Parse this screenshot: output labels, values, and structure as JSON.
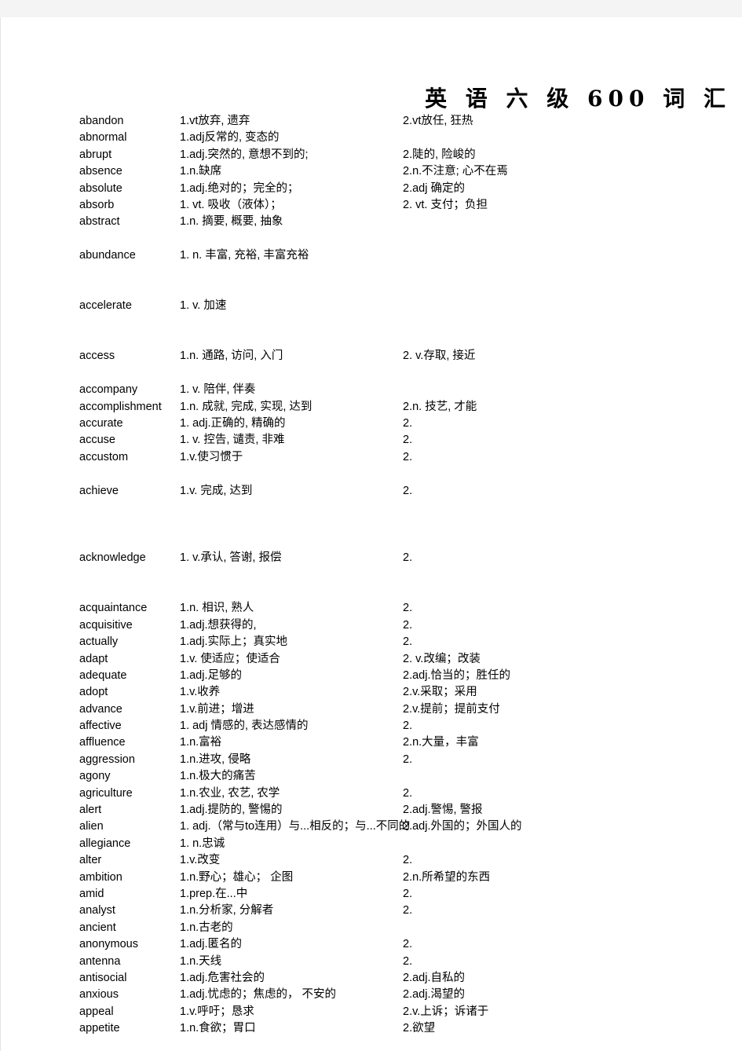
{
  "document": {
    "title": "英 语 六 级 600 词 汇",
    "background_color": "#ffffff",
    "page_background": "#f4f4f4",
    "text_color": "#000000"
  },
  "entries": [
    {
      "word": "abandon",
      "def1": "1.vt放弃, 遗弃",
      "def2": "2.vt放任, 狂热",
      "gap_after": 0
    },
    {
      "word": "abnormal",
      "def1": "1.adj反常的, 变态的",
      "def2": "",
      "gap_after": 0
    },
    {
      "word": "abrupt",
      "def1": "1.adj.突然的, 意想不到的;",
      "def2": "2.陡的, 险峻的",
      "gap_after": 0
    },
    {
      "word": "absence",
      "def1": "1.n.缺席",
      "def2": "2.n.不注意; 心不在焉",
      "gap_after": 0
    },
    {
      "word": "absolute",
      "def1": "1.adj.绝对的；完全的；",
      "def2": "2.adj 确定的",
      "gap_after": 0
    },
    {
      "word": "absorb",
      "def1": "1. vt. 吸收（液体）；",
      "def2": "2. vt. 支付；负担",
      "gap_after": 0
    },
    {
      "word": "abstract",
      "def1": "1.n. 摘要, 概要, 抽象",
      "def2": "",
      "gap_after": 1
    },
    {
      "word": "abundance",
      "def1": "1. n. 丰富, 充裕, 丰富充裕",
      "def2": "",
      "gap_after": 2
    },
    {
      "word": "accelerate",
      "def1": "1. v. 加速",
      "def2": "",
      "gap_after": 2
    },
    {
      "word": "access",
      "def1": "1.n. 通路, 访问, 入门",
      "def2": "2. v.存取, 接近",
      "gap_after": 1
    },
    {
      "word": "accompany",
      "def1": "1. v. 陪伴, 伴奏",
      "def2": "",
      "gap_after": 0
    },
    {
      "word": "accomplishment",
      "def1": "1.n. 成就, 完成, 实现, 达到",
      "def2": "2.n. 技艺, 才能",
      "gap_after": 0
    },
    {
      "word": "accurate",
      "def1": "1. adj.正确的, 精确的",
      "def2": "2.",
      "gap_after": 0
    },
    {
      "word": "accuse",
      "def1": "1. v. 控告, 谴责, 非难",
      "def2": "2.",
      "gap_after": 0
    },
    {
      "word": "accustom",
      "def1": "1.v.使习惯于",
      "def2": "2.",
      "gap_after": 1
    },
    {
      "word": "achieve",
      "def1": "1.v. 完成, 达到",
      "def2": "2.",
      "gap_after": 3
    },
    {
      "word": "acknowledge",
      "def1": "1. v.承认, 答谢, 报偿",
      "def2": "2.",
      "gap_after": 2
    },
    {
      "word": "acquaintance",
      "def1": "1.n. 相识, 熟人",
      "def2": "2.",
      "gap_after": 0
    },
    {
      "word": "acquisitive",
      "def1": "1.adj.想获得的,",
      "def2": "2.",
      "gap_after": 0
    },
    {
      "word": "actually",
      "def1": "1.adj.实际上；真实地",
      "def2": "2.",
      "gap_after": 0
    },
    {
      "word": "adapt",
      "def1": "1.v. 使适应；使适合",
      "def2": "2. v.改编；改装",
      "gap_after": 0
    },
    {
      "word": "adequate",
      "def1": "1.adj.足够的",
      "def2": "2.adj.恰当的；胜任的",
      "gap_after": 0
    },
    {
      "word": "adopt",
      "def1": "1.v.收养",
      "def2": "2.v.采取；采用",
      "gap_after": 0
    },
    {
      "word": "advance",
      "def1": "1.v.前进；增进",
      "def2": "2.v.提前；提前支付",
      "gap_after": 0
    },
    {
      "word": "affective",
      "def1": "1. adj 情感的, 表达感情的",
      "def2": "2.",
      "gap_after": 0
    },
    {
      "word": "affluence",
      "def1": "1.n.富裕",
      "def2": "2.n.大量，丰富",
      "gap_after": 0
    },
    {
      "word": "aggression",
      "def1": "1.n.进攻, 侵略",
      "def2": "2.",
      "gap_after": 0
    },
    {
      "word": "agony",
      "def1": "1.n.极大的痛苦",
      "def2": "",
      "gap_after": 0
    },
    {
      "word": "agriculture",
      "def1": "1.n.农业, 农艺, 农学",
      "def2": "2.",
      "gap_after": 0
    },
    {
      "word": "alert",
      "def1": "1.adj.提防的, 警惕的",
      "def2": "2.adj.警惕, 警报",
      "gap_after": 0
    },
    {
      "word": "alien",
      "def1": "1. adj.（常与to连用）与...相反的；与...不同的",
      "def2": "2.adj.外国的；外国人的",
      "gap_after": 0
    },
    {
      "word": "allegiance",
      "def1": "1. n.忠诚",
      "def2": "",
      "gap_after": 0
    },
    {
      "word": "alter",
      "def1": "1.v.改变",
      "def2": "2.",
      "gap_after": 0
    },
    {
      "word": "ambition",
      "def1": "1.n.野心；雄心； 企图",
      "def2": "2.n.所希望的东西",
      "gap_after": 0
    },
    {
      "word": "amid",
      "def1": "1.prep.在...中",
      "def2": "2.",
      "gap_after": 0
    },
    {
      "word": "analyst",
      "def1": "1.n.分析家, 分解者",
      "def2": "2.",
      "gap_after": 0
    },
    {
      "word": "ancient",
      "def1": "1.n.古老的",
      "def2": "",
      "gap_after": 0
    },
    {
      "word": "anonymous",
      "def1": "1.adj.匿名的",
      "def2": "2.",
      "gap_after": 0
    },
    {
      "word": "antenna",
      "def1": "1.n.天线",
      "def2": "2.",
      "gap_after": 0
    },
    {
      "word": "antisocial",
      "def1": "1.adj.危害社会的",
      "def2": "2.adj.自私的",
      "gap_after": 0
    },
    {
      "word": "anxious",
      "def1": "1.adj.忧虑的；焦虑的， 不安的",
      "def2": "2.adj.渴望的",
      "gap_after": 0
    },
    {
      "word": "appeal",
      "def1": "1.v.呼吁；恳求",
      "def2": "2.v.上诉；诉诸于",
      "gap_after": 0
    },
    {
      "word": "appetite",
      "def1": "1.n.食欲；胃口",
      "def2": "2.欲望",
      "gap_after": 0
    }
  ]
}
